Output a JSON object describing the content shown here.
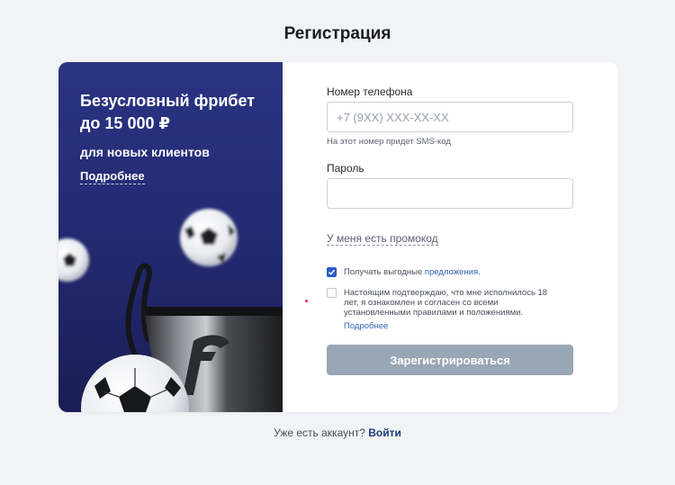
{
  "page": {
    "title": "Регистрация"
  },
  "promo": {
    "title": "Безусловный фрибет до 15 000 ₽",
    "subtitle": "для новых клиентов",
    "more_link": "Подробнее"
  },
  "form": {
    "phone": {
      "label": "Номер телефона",
      "placeholder": "+7 (9XX) XXX-XX-XX",
      "value": "",
      "hint": "На этот номер придет SMS-код"
    },
    "password": {
      "label": "Пароль",
      "value": ""
    },
    "promocode_link": "У меня есть промокод",
    "offers_checkbox": {
      "checked": true,
      "text": "Получать выгодные",
      "link": "предложения."
    },
    "consent_checkbox": {
      "checked": false,
      "text": "Настоящим подтверждаю, что мне исполнилось 18 лет, я ознакомлен и согласен со всеми установленными правилами и положениями.",
      "more_link": "Подробнее"
    },
    "submit_label": "Зарегистрироваться"
  },
  "footer": {
    "text": "Уже есть аккаунт?",
    "login_link": "Войти"
  },
  "colors": {
    "promo_bg": "#232b73",
    "submit_bg": "#99a6b6",
    "accent": "#2c5ec8",
    "page_bg": "#f1f3f6"
  }
}
